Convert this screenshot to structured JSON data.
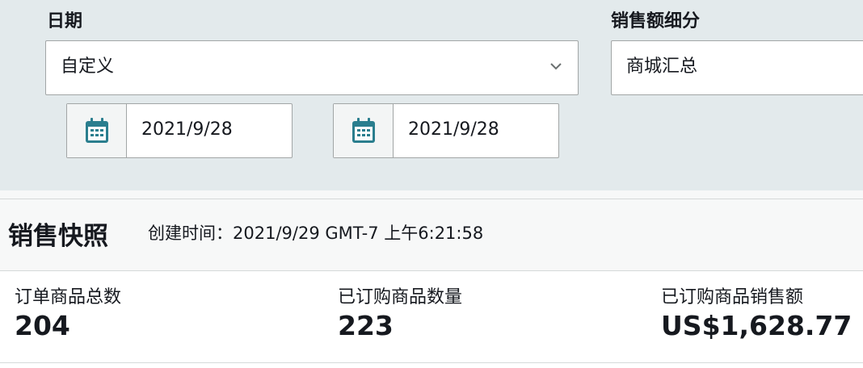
{
  "filters": {
    "date_label": "日期",
    "date_range_value": "自定义",
    "start_date": "2021/9/28",
    "end_date": "2021/9/28",
    "breakdown_label": "销售额细分",
    "breakdown_value": "商城汇总"
  },
  "snapshot": {
    "title": "销售快照",
    "created_time": "创建时间：2021/9/29 GMT-7 上午6:21:58"
  },
  "metrics": [
    {
      "label": "订单商品总数",
      "value": "204"
    },
    {
      "label": "已订购商品数量",
      "value": "223"
    },
    {
      "label": "已订购商品销售额",
      "value": "US$1,628.77"
    }
  ],
  "colors": {
    "panel_bg": "#e3eaec",
    "calendar_icon": "#2a7e8e"
  },
  "icons": {
    "dropdown": "chevron-down-icon",
    "calendar": "calendar-icon"
  }
}
